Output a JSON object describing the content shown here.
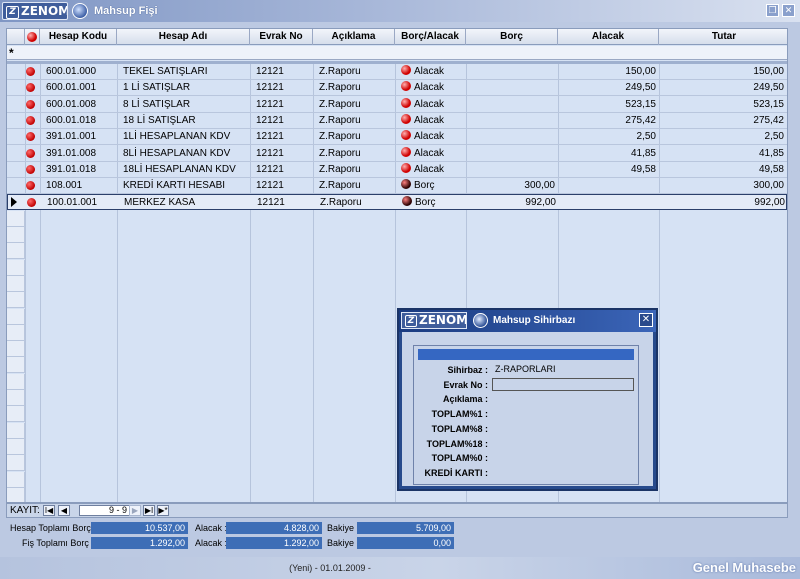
{
  "window": {
    "logo_text": "ZENOM",
    "logo_mark": "Z",
    "title": "Mahsup Fişi",
    "title_icon": "document-icon",
    "restore_glyph": "❐",
    "close_glyph": "✕"
  },
  "grid": {
    "columns": [
      "Hesap Kodu",
      "Hesap Adı",
      "Evrak No",
      "Açıklama",
      "Borç/Alacak",
      "Borç",
      "Alacak",
      "Tutar"
    ],
    "new_row_marker": "*",
    "rows": [
      {
        "code": "600.01.000",
        "name": "TEKEL SATIŞLARI",
        "doc": "12121",
        "desc": "Z.Raporu",
        "type": "Alacak",
        "type_icon": "red",
        "borc": "",
        "alacak": "150,00",
        "tutar": "150,00"
      },
      {
        "code": "600.01.001",
        "name": "1 Lİ SATIŞLAR",
        "doc": "12121",
        "desc": "Z.Raporu",
        "type": "Alacak",
        "type_icon": "red",
        "borc": "",
        "alacak": "249,50",
        "tutar": "249,50"
      },
      {
        "code": "600.01.008",
        "name": "8 Lİ SATIŞLAR",
        "doc": "12121",
        "desc": "Z.Raporu",
        "type": "Alacak",
        "type_icon": "red",
        "borc": "",
        "alacak": "523,15",
        "tutar": "523,15"
      },
      {
        "code": "600.01.018",
        "name": "18 Lİ SATIŞLAR",
        "doc": "12121",
        "desc": "Z.Raporu",
        "type": "Alacak",
        "type_icon": "red",
        "borc": "",
        "alacak": "275,42",
        "tutar": "275,42"
      },
      {
        "code": "391.01.001",
        "name": "1Lİ HESAPLANAN KDV",
        "doc": "12121",
        "desc": "Z.Raporu",
        "type": "Alacak",
        "type_icon": "red",
        "borc": "",
        "alacak": "2,50",
        "tutar": "2,50"
      },
      {
        "code": "391.01.008",
        "name": "8Lİ HESAPLANAN KDV",
        "doc": "12121",
        "desc": "Z.Raporu",
        "type": "Alacak",
        "type_icon": "red",
        "borc": "",
        "alacak": "41,85",
        "tutar": "41,85"
      },
      {
        "code": "391.01.018",
        "name": "18Lİ HESAPLANAN KDV",
        "doc": "12121",
        "desc": "Z.Raporu",
        "type": "Alacak",
        "type_icon": "red",
        "borc": "",
        "alacak": "49,58",
        "tutar": "49,58"
      },
      {
        "code": "108.001",
        "name": "KREDİ KARTI HESABI",
        "doc": "12121",
        "desc": "Z.Raporu",
        "type": "Borç",
        "type_icon": "dark",
        "borc": "300,00",
        "alacak": "",
        "tutar": "300,00"
      },
      {
        "code": "100.01.001",
        "name": "MERKEZ KASA",
        "doc": "12121",
        "desc": "Z.Raporu",
        "type": "Borç",
        "type_icon": "dark",
        "borc": "992,00",
        "alacak": "",
        "tutar": "992,00"
      }
    ],
    "active_row_index": 8
  },
  "navigator": {
    "label": "KAYIT:",
    "position": "9 - 9",
    "first": "I◀",
    "prev": "◀",
    "next": "▶",
    "last": "▶I",
    "add": "▶*"
  },
  "totals": {
    "hesap": {
      "label": "Hesap Toplamı Borç :",
      "borc": "10.537,00",
      "alacak_label": "Alacak :",
      "alacak": "4.828,00",
      "bakiye_label": "Bakiye :",
      "bakiye": "5.709,00"
    },
    "fis": {
      "label": "Fiş Toplamı Borç :",
      "borc": "1.292,00",
      "alacak_label": "Alacak :",
      "alacak": "1.292,00",
      "bakiye_label": "Bakiye :",
      "bakiye": "0,00"
    }
  },
  "status": {
    "center": "(Yeni) - 01.01.2009 -",
    "module": "Genel Muhasebe"
  },
  "dialog": {
    "logo_text": "ZENOM",
    "logo_mark": "Z",
    "title": "Mahsup Sihirbazı",
    "close_glyph": "✕",
    "fields": [
      {
        "label": "Sihirbaz :",
        "value": "Z-RAPORLARI"
      },
      {
        "label": "Evrak No :",
        "value": ""
      },
      {
        "label": "Açıklama :",
        "value": ""
      },
      {
        "label": "TOPLAM%1 :",
        "value": ""
      },
      {
        "label": "TOPLAM%8 :",
        "value": ""
      },
      {
        "label": "TOPLAM%18 :",
        "value": ""
      },
      {
        "label": "TOPLAM%0 :",
        "value": ""
      },
      {
        "label": "KREDİ KARTI :",
        "value": ""
      }
    ]
  },
  "colors": {
    "accent": "#3e6eb6",
    "title_bar": "#8ea2cc",
    "grid_bg": "#d6e2f4",
    "row_dot": "#c00000",
    "dialog_frame": "#274a8c"
  }
}
